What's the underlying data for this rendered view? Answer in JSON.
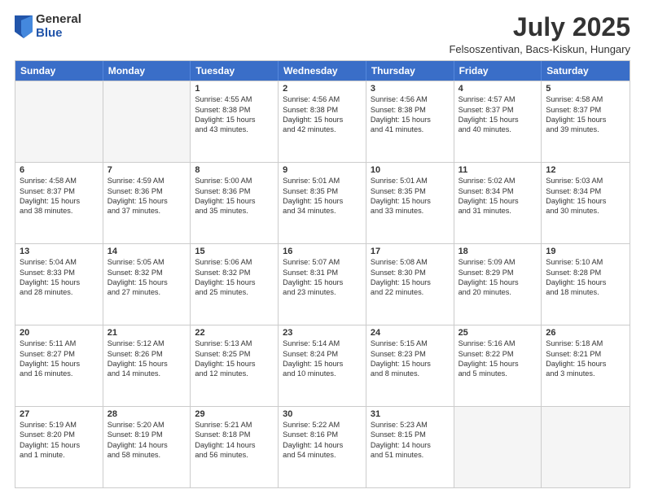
{
  "header": {
    "logo": {
      "general": "General",
      "blue": "Blue"
    },
    "month_year": "July 2025",
    "location": "Felsoszentivan, Bacs-Kiskun, Hungary"
  },
  "days_of_week": [
    "Sunday",
    "Monday",
    "Tuesday",
    "Wednesday",
    "Thursday",
    "Friday",
    "Saturday"
  ],
  "weeks": [
    [
      {
        "day": "",
        "sunrise": "",
        "sunset": "",
        "daylight": "",
        "empty": true
      },
      {
        "day": "",
        "sunrise": "",
        "sunset": "",
        "daylight": "",
        "empty": true
      },
      {
        "day": "1",
        "sunrise": "Sunrise: 4:55 AM",
        "sunset": "Sunset: 8:38 PM",
        "daylight": "Daylight: 15 hours and 43 minutes."
      },
      {
        "day": "2",
        "sunrise": "Sunrise: 4:56 AM",
        "sunset": "Sunset: 8:38 PM",
        "daylight": "Daylight: 15 hours and 42 minutes."
      },
      {
        "day": "3",
        "sunrise": "Sunrise: 4:56 AM",
        "sunset": "Sunset: 8:38 PM",
        "daylight": "Daylight: 15 hours and 41 minutes."
      },
      {
        "day": "4",
        "sunrise": "Sunrise: 4:57 AM",
        "sunset": "Sunset: 8:37 PM",
        "daylight": "Daylight: 15 hours and 40 minutes."
      },
      {
        "day": "5",
        "sunrise": "Sunrise: 4:58 AM",
        "sunset": "Sunset: 8:37 PM",
        "daylight": "Daylight: 15 hours and 39 minutes."
      }
    ],
    [
      {
        "day": "6",
        "sunrise": "Sunrise: 4:58 AM",
        "sunset": "Sunset: 8:37 PM",
        "daylight": "Daylight: 15 hours and 38 minutes."
      },
      {
        "day": "7",
        "sunrise": "Sunrise: 4:59 AM",
        "sunset": "Sunset: 8:36 PM",
        "daylight": "Daylight: 15 hours and 37 minutes."
      },
      {
        "day": "8",
        "sunrise": "Sunrise: 5:00 AM",
        "sunset": "Sunset: 8:36 PM",
        "daylight": "Daylight: 15 hours and 35 minutes."
      },
      {
        "day": "9",
        "sunrise": "Sunrise: 5:01 AM",
        "sunset": "Sunset: 8:35 PM",
        "daylight": "Daylight: 15 hours and 34 minutes."
      },
      {
        "day": "10",
        "sunrise": "Sunrise: 5:01 AM",
        "sunset": "Sunset: 8:35 PM",
        "daylight": "Daylight: 15 hours and 33 minutes."
      },
      {
        "day": "11",
        "sunrise": "Sunrise: 5:02 AM",
        "sunset": "Sunset: 8:34 PM",
        "daylight": "Daylight: 15 hours and 31 minutes."
      },
      {
        "day": "12",
        "sunrise": "Sunrise: 5:03 AM",
        "sunset": "Sunset: 8:34 PM",
        "daylight": "Daylight: 15 hours and 30 minutes."
      }
    ],
    [
      {
        "day": "13",
        "sunrise": "Sunrise: 5:04 AM",
        "sunset": "Sunset: 8:33 PM",
        "daylight": "Daylight: 15 hours and 28 minutes."
      },
      {
        "day": "14",
        "sunrise": "Sunrise: 5:05 AM",
        "sunset": "Sunset: 8:32 PM",
        "daylight": "Daylight: 15 hours and 27 minutes."
      },
      {
        "day": "15",
        "sunrise": "Sunrise: 5:06 AM",
        "sunset": "Sunset: 8:32 PM",
        "daylight": "Daylight: 15 hours and 25 minutes."
      },
      {
        "day": "16",
        "sunrise": "Sunrise: 5:07 AM",
        "sunset": "Sunset: 8:31 PM",
        "daylight": "Daylight: 15 hours and 23 minutes."
      },
      {
        "day": "17",
        "sunrise": "Sunrise: 5:08 AM",
        "sunset": "Sunset: 8:30 PM",
        "daylight": "Daylight: 15 hours and 22 minutes."
      },
      {
        "day": "18",
        "sunrise": "Sunrise: 5:09 AM",
        "sunset": "Sunset: 8:29 PM",
        "daylight": "Daylight: 15 hours and 20 minutes."
      },
      {
        "day": "19",
        "sunrise": "Sunrise: 5:10 AM",
        "sunset": "Sunset: 8:28 PM",
        "daylight": "Daylight: 15 hours and 18 minutes."
      }
    ],
    [
      {
        "day": "20",
        "sunrise": "Sunrise: 5:11 AM",
        "sunset": "Sunset: 8:27 PM",
        "daylight": "Daylight: 15 hours and 16 minutes."
      },
      {
        "day": "21",
        "sunrise": "Sunrise: 5:12 AM",
        "sunset": "Sunset: 8:26 PM",
        "daylight": "Daylight: 15 hours and 14 minutes."
      },
      {
        "day": "22",
        "sunrise": "Sunrise: 5:13 AM",
        "sunset": "Sunset: 8:25 PM",
        "daylight": "Daylight: 15 hours and 12 minutes."
      },
      {
        "day": "23",
        "sunrise": "Sunrise: 5:14 AM",
        "sunset": "Sunset: 8:24 PM",
        "daylight": "Daylight: 15 hours and 10 minutes."
      },
      {
        "day": "24",
        "sunrise": "Sunrise: 5:15 AM",
        "sunset": "Sunset: 8:23 PM",
        "daylight": "Daylight: 15 hours and 8 minutes."
      },
      {
        "day": "25",
        "sunrise": "Sunrise: 5:16 AM",
        "sunset": "Sunset: 8:22 PM",
        "daylight": "Daylight: 15 hours and 5 minutes."
      },
      {
        "day": "26",
        "sunrise": "Sunrise: 5:18 AM",
        "sunset": "Sunset: 8:21 PM",
        "daylight": "Daylight: 15 hours and 3 minutes."
      }
    ],
    [
      {
        "day": "27",
        "sunrise": "Sunrise: 5:19 AM",
        "sunset": "Sunset: 8:20 PM",
        "daylight": "Daylight: 15 hours and 1 minute."
      },
      {
        "day": "28",
        "sunrise": "Sunrise: 5:20 AM",
        "sunset": "Sunset: 8:19 PM",
        "daylight": "Daylight: 14 hours and 58 minutes."
      },
      {
        "day": "29",
        "sunrise": "Sunrise: 5:21 AM",
        "sunset": "Sunset: 8:18 PM",
        "daylight": "Daylight: 14 hours and 56 minutes."
      },
      {
        "day": "30",
        "sunrise": "Sunrise: 5:22 AM",
        "sunset": "Sunset: 8:16 PM",
        "daylight": "Daylight: 14 hours and 54 minutes."
      },
      {
        "day": "31",
        "sunrise": "Sunrise: 5:23 AM",
        "sunset": "Sunset: 8:15 PM",
        "daylight": "Daylight: 14 hours and 51 minutes."
      },
      {
        "day": "",
        "sunrise": "",
        "sunset": "",
        "daylight": "",
        "empty": true
      },
      {
        "day": "",
        "sunrise": "",
        "sunset": "",
        "daylight": "",
        "empty": true
      }
    ]
  ]
}
